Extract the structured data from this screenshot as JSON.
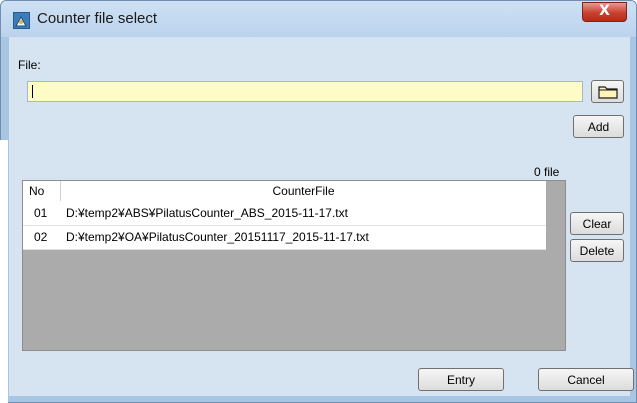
{
  "window": {
    "title": "Counter file select",
    "close_glyph": "X"
  },
  "form": {
    "file_label": "File:",
    "file_value": "",
    "folder_icon": "folder-icon",
    "add_label": "Add",
    "file_count": "0 file"
  },
  "grid": {
    "columns": [
      "No",
      "CounterFile"
    ],
    "rows": [
      {
        "no": "01",
        "file": "D:¥temp2¥ABS¥PilatusCounter_ABS_2015-11-17.txt"
      },
      {
        "no": "02",
        "file": "D:¥temp2¥OA¥PilatusCounter_20151117_2015-11-17.txt"
      }
    ]
  },
  "side_buttons": {
    "clear_label": "Clear",
    "delete_label": "Delete"
  },
  "footer": {
    "entry_label": "Entry",
    "cancel_label": "Cancel"
  },
  "colors": {
    "input_bg": "#fdfcc6",
    "client_bg": "#d6e4f1",
    "grid_empty_bg": "#ababab",
    "close_red": "#c8412e"
  }
}
